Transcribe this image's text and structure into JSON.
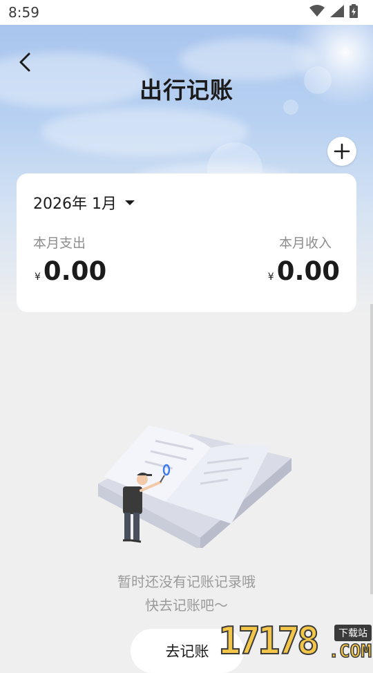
{
  "status_bar": {
    "time": "8:59",
    "icons": [
      "wifi-icon",
      "signal-icon",
      "battery-icon"
    ]
  },
  "header": {
    "title": "出行记账",
    "back_icon": "chevron-left-icon",
    "add_icon": "plus-icon"
  },
  "summary": {
    "month": "2026年 1月",
    "expense_label": "本月支出",
    "expense_currency": "¥",
    "expense_amount": "0.00",
    "income_label": "本月收入",
    "income_currency": "¥",
    "income_amount": "0.00"
  },
  "empty_state": {
    "line1": "暂时还没有记账记录哦",
    "line2": "快去记账吧～",
    "button_label": "去记账"
  },
  "watermark": {
    "digits": "17178",
    "badge": "下载站",
    "suffix": ".COM"
  },
  "colors": {
    "accent": "#f3c64a",
    "text": "#1b1b1b",
    "muted": "#9a9a9a",
    "background": "#efefef"
  }
}
